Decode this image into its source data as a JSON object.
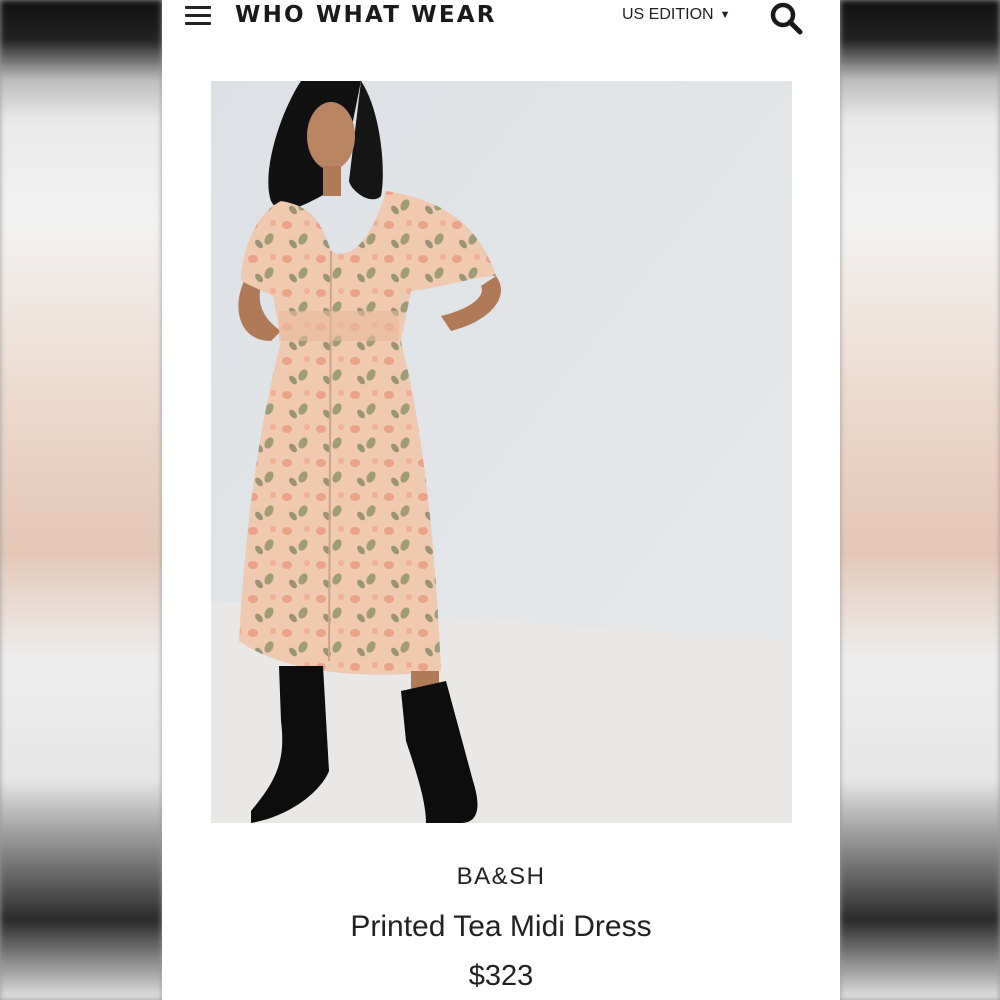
{
  "header": {
    "logo": "WHO WHAT WEAR",
    "edition": "US EDITION",
    "menu_icon": "hamburger-menu-icon",
    "search_icon": "search-icon",
    "edition_caret_icon": "caret-down-icon"
  },
  "product": {
    "brand": "BA&SH",
    "name": "Printed Tea Midi Dress",
    "price": "$323"
  },
  "colors": {
    "text": "#222222",
    "page_background": "#ffffff",
    "photo_background": "#e3e5e8",
    "dress": "#efc7ad"
  }
}
